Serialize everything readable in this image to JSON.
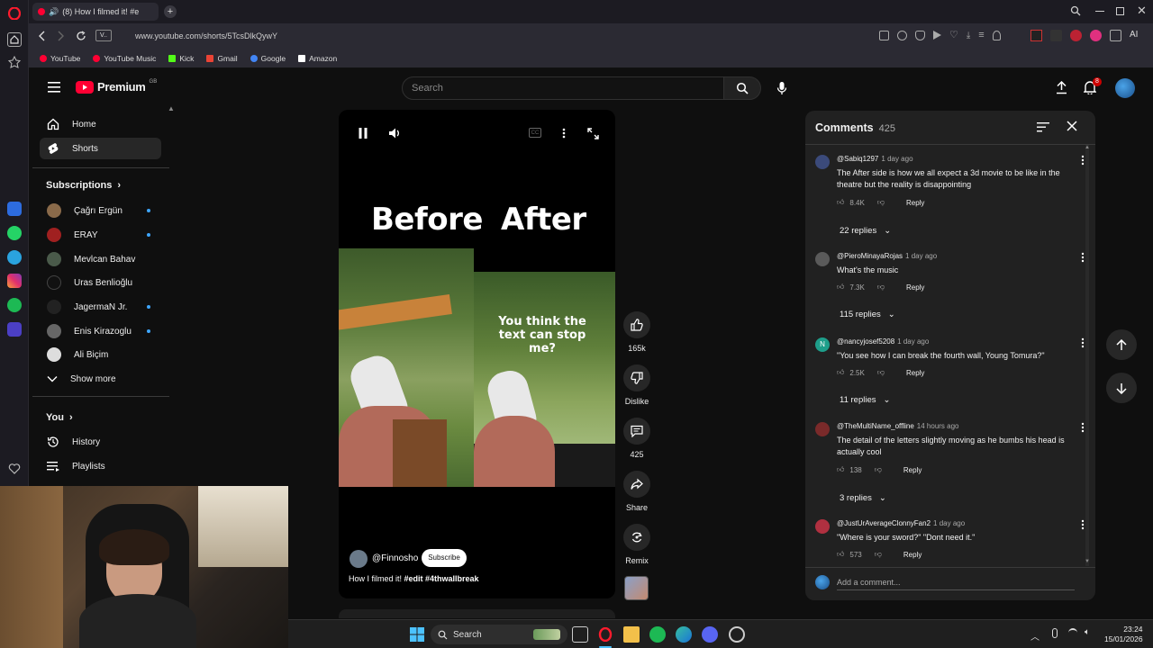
{
  "browser": {
    "tab_title": "(8) How I filmed it! #e",
    "url_badge": "V..",
    "url": "www.youtube.com/shorts/5TcsDlkQywY",
    "ai_label": "AI",
    "bookmarks": [
      {
        "label": "YouTube",
        "color": "#ff0033"
      },
      {
        "label": "YouTube Music",
        "color": "#ff0033"
      },
      {
        "label": "Kick",
        "color": "#53fc18"
      },
      {
        "label": "Gmail",
        "color": "#ea4335"
      },
      {
        "label": "Google",
        "color": "#4285f4"
      },
      {
        "label": "Amazon",
        "color": "#ffffff"
      }
    ]
  },
  "masthead": {
    "logo_text": "Premium",
    "logo_sup": "GB",
    "search_placeholder": "Search",
    "notification_count": "8"
  },
  "guide": {
    "home": "Home",
    "shorts": "Shorts",
    "subscriptions_title": "Subscriptions",
    "subscriptions": [
      {
        "name": "Çağrı Ergün",
        "live": true
      },
      {
        "name": "ERAY",
        "live": true
      },
      {
        "name": "Mevlcan Bahav",
        "live": false
      },
      {
        "name": "Uras Benlioğlu",
        "live": false
      },
      {
        "name": "JagermaN Jr.",
        "live": true
      },
      {
        "name": "Enis Kirazoglu",
        "live": true
      },
      {
        "name": "Ali Biçim",
        "live": false
      }
    ],
    "show_more": "Show more",
    "you_title": "You",
    "history": "History",
    "playlists": "Playlists"
  },
  "player": {
    "word_before": "Before",
    "word_after": "After",
    "overlay_text": "You think the text can stop me?",
    "channel": "@Finnosho",
    "subscribe": "Subscribe",
    "description": "How I filmed it!",
    "hashtags": "#edit #4thwallbreak"
  },
  "actions": {
    "likes": "165k",
    "dislike": "Dislike",
    "comments": "425",
    "share": "Share",
    "remix": "Remix"
  },
  "comments_panel": {
    "title": "Comments",
    "count": "425",
    "add_placeholder": "Add a comment...",
    "reply_label": "Reply",
    "items": [
      {
        "user": "@Sabiq1297",
        "ago": "1 day ago",
        "text": "The After side is how we all expect a 3d movie to be like in the theatre but the reality is disappointing",
        "likes": "8.4K",
        "replies": "22 replies",
        "avatar": "#3b4a7a"
      },
      {
        "user": "@PieroMinayaRojas",
        "ago": "1 day ago",
        "text": "What's the music",
        "likes": "7.3K",
        "replies": "115 replies",
        "avatar": "#5a5a5a"
      },
      {
        "user": "@nancyjosef5208",
        "ago": "1 day ago",
        "text": "\"You see how I can break the fourth wall, Young Tomura?\"",
        "likes": "2.5K",
        "replies": "11 replies",
        "avatar": "#1e9e8a",
        "initial": "N"
      },
      {
        "user": "@TheMultiName_offline",
        "ago": "14 hours ago",
        "text": "The detail of the letters slightly moving as he bumbs his head is actually cool",
        "likes": "138",
        "replies": "3 replies",
        "avatar": "#7a2a2a"
      },
      {
        "user": "@JustUrAverageClonnyFan2",
        "ago": "1 day ago",
        "text": "\"Where is your sword?\" \"Dont need it.\"",
        "likes": "573",
        "replies": "",
        "avatar": "#b03040"
      }
    ]
  },
  "taskbar": {
    "search": "Search",
    "time": "23:24",
    "date": "15/01/2026"
  },
  "colors": {
    "yt_red": "#ff0033",
    "accent_blue": "#3ea6ff",
    "bg": "#0f0f0f",
    "panel": "#212121"
  }
}
